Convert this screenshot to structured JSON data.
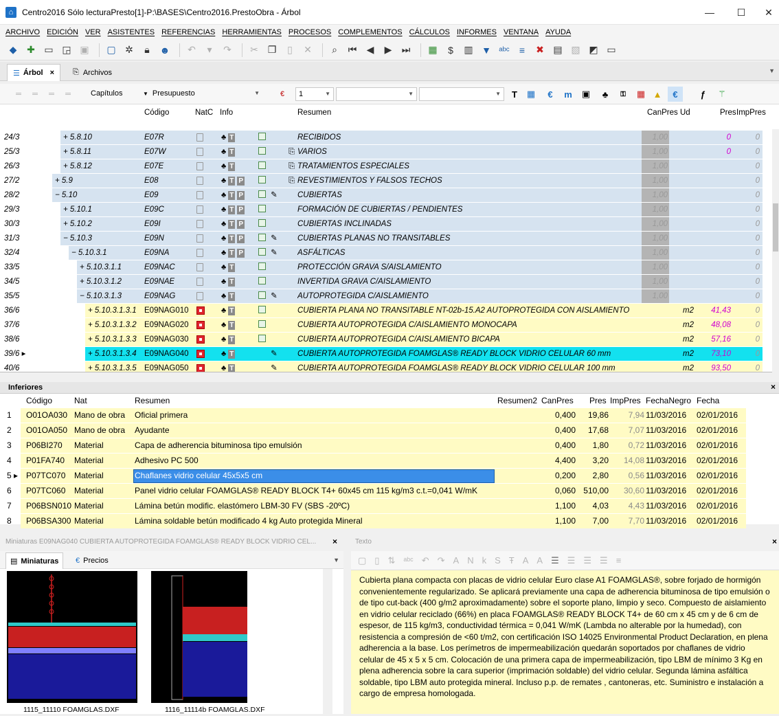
{
  "window": {
    "title": "Centro2016 Sólo lecturaPresto[1]-P:\\BASES\\Centro2016.PrestoObra - Árbol",
    "minimize": "—",
    "maximize": "☐",
    "close": "✕"
  },
  "menu": [
    "ARCHIVO",
    "EDICIÓN",
    "VER",
    "ASISTENTES",
    "REFERENCIAS",
    "HERRAMIENTAS",
    "PROCESOS",
    "COMPLEMENTOS",
    "CÁLCULOS",
    "INFORMES",
    "VENTANA",
    "AYUDA"
  ],
  "tabs": {
    "arbol": "Árbol",
    "archivos": "Archivos",
    "close": "×"
  },
  "filter": {
    "level": "Capítulos",
    "view": "Presupuesto",
    "number": "1"
  },
  "tree_headers": {
    "codigo": "Código",
    "natc": "NatC",
    "info": "Info",
    "resumen": "Resumen",
    "canpres": "CanPres",
    "ud": "Ud",
    "pres": "Pres",
    "imppres": "ImpPres"
  },
  "tree_rows": [
    {
      "n": "24/3",
      "lvl": "+ 5.8.10",
      "code": "E07R",
      "info": "AT",
      "resumen": "RECIBIDOS",
      "canpres": "1,00",
      "ud": "",
      "pres": "0",
      "imp": "0",
      "style": "blue",
      "level": 2
    },
    {
      "n": "25/3",
      "lvl": "+ 5.8.11",
      "code": "E07W",
      "info": "AT",
      "clip": true,
      "resumen": "VARIOS",
      "canpres": "1,00",
      "ud": "",
      "pres": "0",
      "imp": "0",
      "style": "blue",
      "level": 2
    },
    {
      "n": "26/3",
      "lvl": "+ 5.8.12",
      "code": "E07E",
      "info": "AT",
      "clip": true,
      "resumen": "TRATAMIENTOS ESPECIALES",
      "canpres": "1,00",
      "ud": "",
      "pres": "",
      "imp": "0",
      "style": "blue",
      "level": 2
    },
    {
      "n": "27/2",
      "lvl": "+ 5.9",
      "code": "E08",
      "info": "ATP",
      "clip": true,
      "resumen": "REVESTIMIENTOS Y FALSOS TECHOS",
      "canpres": "1,00",
      "ud": "",
      "pres": "",
      "imp": "0",
      "style": "blue",
      "level": 1
    },
    {
      "n": "28/2",
      "lvl": "− 5.10",
      "code": "E09",
      "info": "ATPE",
      "resumen": "CUBIERTAS",
      "canpres": "1,00",
      "ud": "",
      "pres": "",
      "imp": "0",
      "style": "blue",
      "level": 1
    },
    {
      "n": "29/3",
      "lvl": "+ 5.10.1",
      "code": "E09C",
      "info": "ATP",
      "resumen": "FORMACIÓN DE CUBIERTAS / PENDIENTES",
      "canpres": "1,00",
      "ud": "",
      "pres": "",
      "imp": "0",
      "style": "blue",
      "level": 2
    },
    {
      "n": "30/3",
      "lvl": "+ 5.10.2",
      "code": "E09I",
      "info": "ATP",
      "resumen": "CUBIERTAS INCLINADAS",
      "canpres": "1,00",
      "ud": "",
      "pres": "",
      "imp": "0",
      "style": "blue",
      "level": 2
    },
    {
      "n": "31/3",
      "lvl": "− 5.10.3",
      "code": "E09N",
      "info": "ATPE",
      "resumen": "CUBIERTAS PLANAS NO TRANSITABLES",
      "canpres": "1,00",
      "ud": "",
      "pres": "",
      "imp": "0",
      "style": "blue",
      "level": 2
    },
    {
      "n": "32/4",
      "lvl": "− 5.10.3.1",
      "code": "E09NA",
      "info": "ATPE",
      "resumen": "ASFÁLTICAS",
      "canpres": "1,00",
      "ud": "",
      "pres": "",
      "imp": "0",
      "style": "blue",
      "level": 3
    },
    {
      "n": "33/5",
      "lvl": "+ 5.10.3.1.1",
      "code": "E09NAC",
      "info": "AT",
      "resumen": "PROTECCIÓN GRAVA S/AISLAMIENTO",
      "canpres": "1,00",
      "ud": "",
      "pres": "",
      "imp": "0",
      "style": "blue",
      "level": 4
    },
    {
      "n": "34/5",
      "lvl": "+ 5.10.3.1.2",
      "code": "E09NAE",
      "info": "AT",
      "resumen": "INVERTIDA GRAVA C/AISLAMIENTO",
      "canpres": "1,00",
      "ud": "",
      "pres": "",
      "imp": "0",
      "style": "blue",
      "level": 4
    },
    {
      "n": "35/5",
      "lvl": "− 5.10.3.1.3",
      "code": "E09NAG",
      "info": "ATE",
      "resumen": "AUTOPROTEGIDA C/AISLAMIENTO",
      "canpres": "1,00",
      "ud": "",
      "pres": "",
      "imp": "0",
      "style": "blue",
      "level": 4
    },
    {
      "n": "36/6",
      "lvl": "+ 5.10.3.1.3.1",
      "code": "E09NAG010",
      "info": "AT",
      "red": true,
      "resumen": "CUBIERTA PLANA NO TRANSITABLE NT-02b-15.A2 AUTOPROTEGIDA CON AISLAMIENTO",
      "canpres": "",
      "ud": "m2",
      "pres": "41,43",
      "imp": "0",
      "style": "yellow",
      "level": 5
    },
    {
      "n": "37/6",
      "lvl": "+ 5.10.3.1.3.2",
      "code": "E09NAG020",
      "info": "AT",
      "red": true,
      "resumen": "CUBIERTA AUTOPROTEGIDA C/AISLAMIENTO MONOCAPA",
      "canpres": "",
      "ud": "m2",
      "pres": "48,08",
      "imp": "0",
      "style": "yellow",
      "level": 5
    },
    {
      "n": "38/6",
      "lvl": "+ 5.10.3.1.3.3",
      "code": "E09NAG030",
      "info": "AT",
      "red": true,
      "resumen": "CUBIERTA AUTOPROTEGIDA C/AISLAMIENTO BICAPA",
      "canpres": "",
      "ud": "m2",
      "pres": "57,16",
      "imp": "0",
      "style": "yellow",
      "level": 5
    },
    {
      "n": "39/6 ▸",
      "lvl": "+ 5.10.3.1.3.4",
      "code": "E09NAG040",
      "info": "AT",
      "red": true,
      "pen": true,
      "resumen": "CUBIERTA AUTOPROTEGIDA FOAMGLAS® READY BLOCK VIDRIO CELULAR 60 mm",
      "canpres": "",
      "ud": "m2",
      "pres": "73,10",
      "imp": "0",
      "style": "cyan",
      "level": 5
    },
    {
      "n": "40/6",
      "lvl": "+ 5.10.3.1.3.5",
      "code": "E09NAG050",
      "info": "AT",
      "red": true,
      "pen": true,
      "resumen": "CUBIERTA AUTOPROTEGIDA FOAMGLAS® READY BLOCK VIDRIO CELULAR 100 mm",
      "canpres": "",
      "ud": "m2",
      "pres": "93,50",
      "imp": "0",
      "style": "yellow",
      "level": 5
    }
  ],
  "inferiores": {
    "title": "Inferiores",
    "headers": {
      "codigo": "Código",
      "nat": "Nat",
      "resumen": "Resumen",
      "resumen2": "Resumen2",
      "canpres": "CanPres",
      "pres": "Pres",
      "imppres": "ImpPres",
      "fechanegro": "FechaNegro",
      "fecha": "Fecha"
    },
    "rows": [
      {
        "n": "1",
        "code": "O01OA030",
        "nat": "Mano de obra",
        "resumen": "Oficial primera",
        "can": "0,400",
        "pres": "19,86",
        "imp": "7,94",
        "fn": "11/03/2016",
        "f": "02/01/2016"
      },
      {
        "n": "2",
        "code": "O01OA050",
        "nat": "Mano de obra",
        "resumen": "Ayudante",
        "can": "0,400",
        "pres": "17,68",
        "imp": "7,07",
        "fn": "11/03/2016",
        "f": "02/01/2016"
      },
      {
        "n": "3",
        "code": "P06BI270",
        "nat": "Material",
        "resumen": "Capa de adherencia bituminosa tipo emulsión",
        "can": "0,400",
        "pres": "1,80",
        "imp": "0,72",
        "fn": "11/03/2016",
        "f": "02/01/2016"
      },
      {
        "n": "4",
        "code": "P01FA740",
        "nat": "Material",
        "resumen": "Adhesivo PC 500",
        "can": "4,400",
        "pres": "3,20",
        "imp": "14,08",
        "fn": "11/03/2016",
        "f": "02/01/2016"
      },
      {
        "n": "5 ▸",
        "code": "P07TC070",
        "nat": "Material",
        "resumen": "Chaflanes vidrio celular 45x5x5 cm",
        "can": "0,200",
        "pres": "2,80",
        "imp": "0,56",
        "fn": "11/03/2016",
        "f": "02/01/2016",
        "selected": true
      },
      {
        "n": "6",
        "code": "P07TC060",
        "nat": "Material",
        "resumen": "Panel vidrio celular FOAMGLAS® READY BLOCK T4+ 60x45 cm 115 kg/m3 c.t.=0,041 W/mK",
        "can": "0,060",
        "pres": "510,00",
        "imp": "30,60",
        "fn": "11/03/2016",
        "f": "02/01/2016"
      },
      {
        "n": "7",
        "code": "P06BSN010",
        "nat": "Material",
        "resumen": "Lámina betún modific. elastómero LBM-30 FV (SBS -20ºC)",
        "can": "1,100",
        "pres": "4,03",
        "imp": "4,43",
        "fn": "11/03/2016",
        "f": "02/01/2016"
      },
      {
        "n": "8",
        "code": "P06BSA300",
        "nat": "Material",
        "resumen": "Lámina soldable betún modificado 4 kg Auto protegida Mineral",
        "can": "1,100",
        "pres": "7,00",
        "imp": "7,70",
        "fn": "11/03/2016",
        "f": "02/01/2016"
      }
    ]
  },
  "miniaturas": {
    "header": "Miniaturas E09NAG040 CUBIERTA AUTOPROTEGIDA FOAMGLAS® READY BLOCK VIDRIO CEL...",
    "tab1": "Miniaturas",
    "tab2": "Precios",
    "cap1": "1115_11110 FOAMGLAS.DXF",
    "cap2": "1116_11114b FOAMGLAS.DXF"
  },
  "texto": {
    "header": "Texto",
    "body": "Cubierta plana compacta con placas de vidrio celular Euro clase A1 FOAMGLAS®, sobre forjado de hormigón convenientemente regularizado. Se aplicará previamente una capa de adherencia bituminosa de tipo emulsión o de tipo cut-back (400 g/m2 aproximadamente) sobre el soporte plano, limpio y seco. Compuesto de aislamiento en vidrio celular reciclado (66%) en placa FOAMGLAS® READY BLOCK T4+ de 60 cm x 45 cm y de 6 cm de espesor, de 115 kg/m3, conductividad térmica = 0,041 W/mK (Lambda no alterable por la humedad), con resistencia a compresión de <60 t/m2, con certificación ISO 14025 Environmental Product Declaration, en plena adherencia a la base. Los perímetros de impermeabilización quedarán soportados por chaflanes de vidrio celular de 45 x 5 x 5 cm. Colocación de una primera capa de impermeabilización, tipo LBM de mínimo 3 Kg en plena adherencia sobre la cara superior (imprimación soldable) del vidrio celular. Segunda lámina asfáltica soldable, tipo LBM auto protegida mineral. Incluso p.p. de remates , cantoneras, etc. Suministro e instalación a cargo de empresa homologada."
  },
  "colors": {
    "blue_row": "#d6e3f0",
    "yellow_row": "#fffbc4",
    "cyan_row": "#13e1ef",
    "pres_magenta": "#d000d0",
    "selection": "#3b8ee8"
  }
}
